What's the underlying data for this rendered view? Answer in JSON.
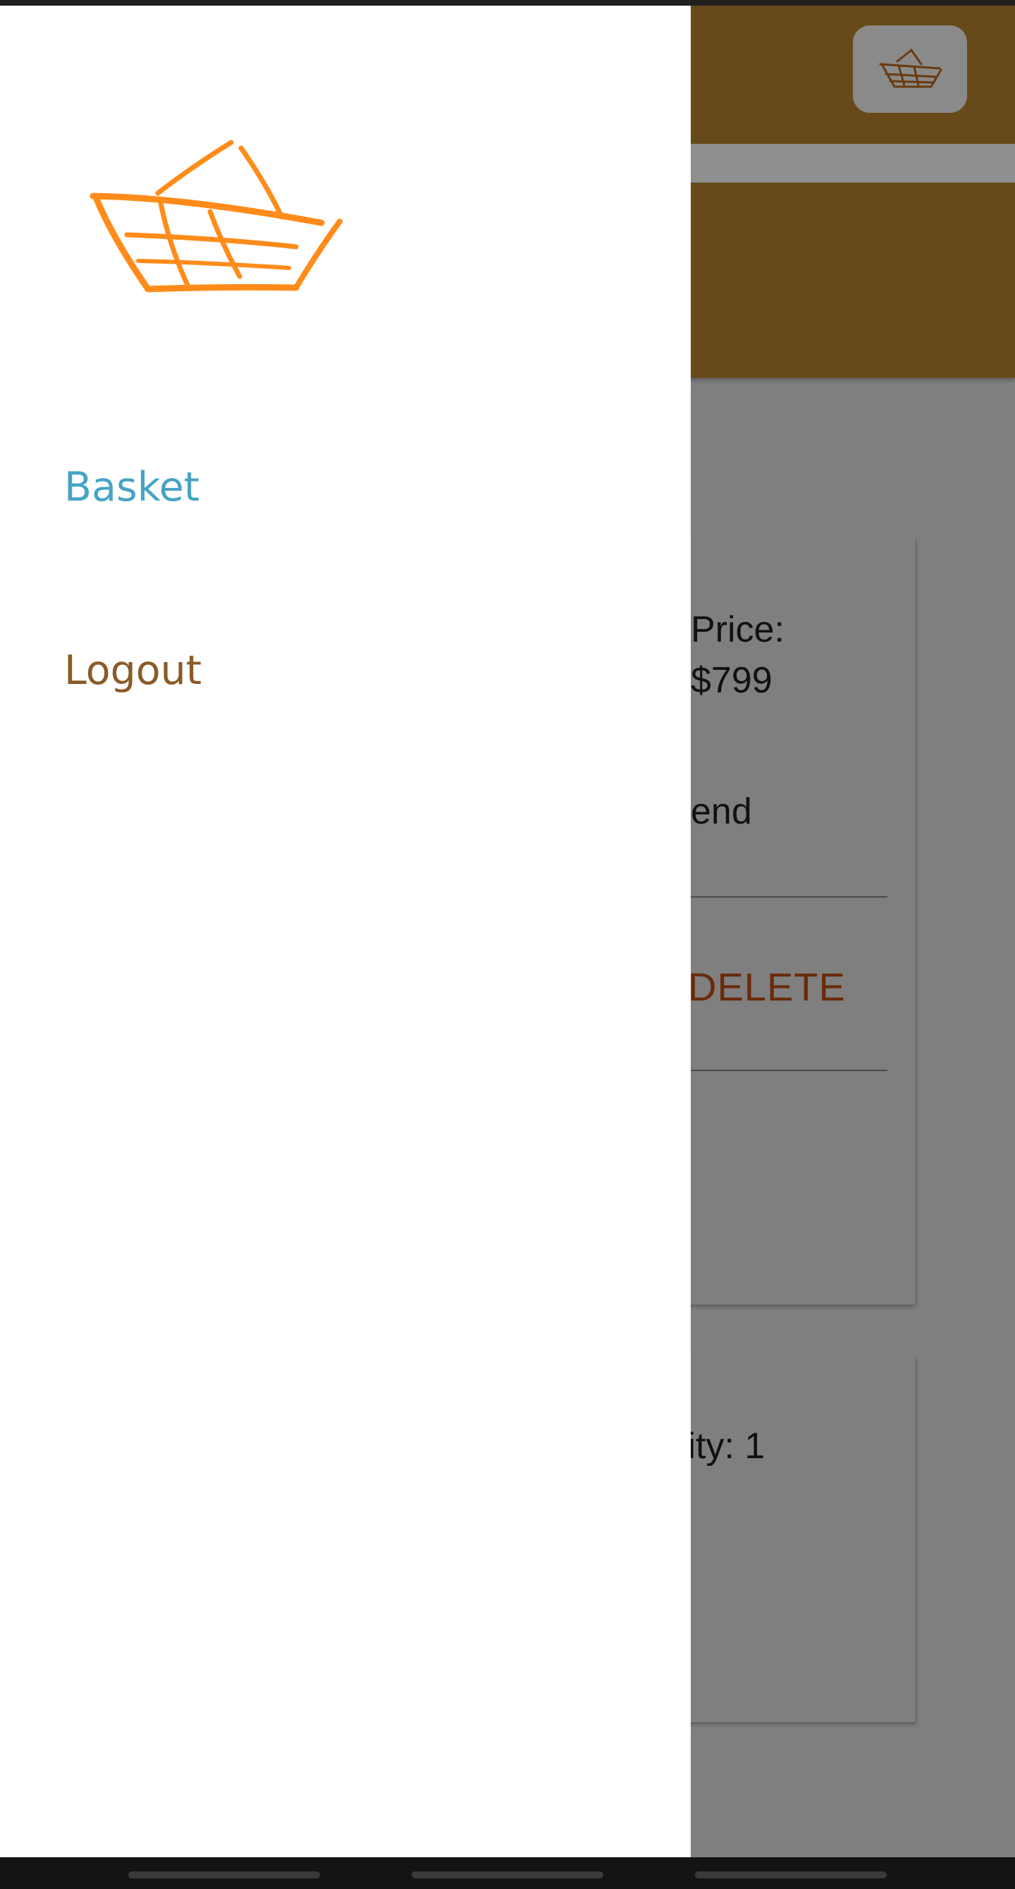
{
  "background": {
    "header": {
      "basket_icon": "basket-icon"
    },
    "card1": {
      "price_label": "Price:",
      "price_value": "$799",
      "spend_fragment": "end",
      "delete_fragment": "DELETE"
    },
    "card2": {
      "quantity_fragment": "tity: 1"
    }
  },
  "drawer": {
    "logo_icon": "basket-logo-icon",
    "items": [
      {
        "label": "Basket",
        "color": "#47a3c5"
      },
      {
        "label": "Logout",
        "color": "#8a5a27"
      }
    ]
  },
  "colors": {
    "header_brown": "#684919",
    "logo_orange": "#ff8c1a",
    "delete_red": "#6b2a0a"
  }
}
